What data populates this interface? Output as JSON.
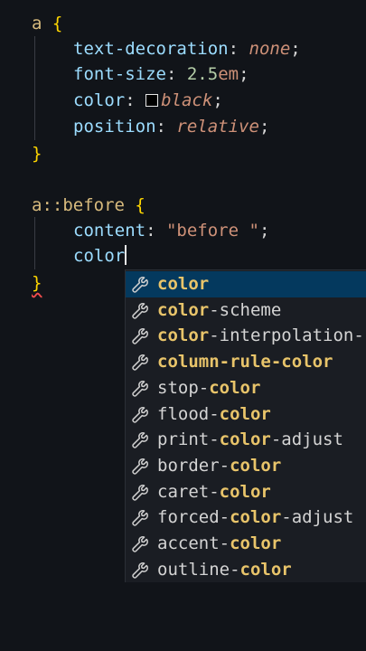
{
  "code": {
    "rule1_selector": "a",
    "open_brace": "{",
    "close_brace": "}",
    "decl1_prop": "text-decoration",
    "decl1_value": "none",
    "decl2_prop": "font-size",
    "decl2_num": "2.5",
    "decl2_unit": "em",
    "decl3_prop": "color",
    "decl3_value": "black",
    "decl4_prop": "position",
    "decl4_value": "relative",
    "rule2_selector_tag": "a",
    "rule2_pseudo": "::before",
    "content_prop": "content",
    "content_value": "\"before \"",
    "typing_text": "color",
    "colon": ":",
    "semicolon": ";"
  },
  "suggestions": {
    "highlight": "color",
    "items": [
      {
        "pre": "",
        "match": "color",
        "post": ""
      },
      {
        "pre": "",
        "match": "color",
        "post": "-scheme"
      },
      {
        "pre": "",
        "match": "color",
        "post": "-interpolation-"
      },
      {
        "pre": "",
        "match": "column-rule-color",
        "post": ""
      },
      {
        "pre": "stop-",
        "match": "color",
        "post": ""
      },
      {
        "pre": "flood-",
        "match": "color",
        "post": ""
      },
      {
        "pre": "print-",
        "match": "color",
        "post": "-adjust"
      },
      {
        "pre": "border-",
        "match": "color",
        "post": ""
      },
      {
        "pre": "caret-",
        "match": "color",
        "post": ""
      },
      {
        "pre": "forced-",
        "match": "color",
        "post": "-adjust"
      },
      {
        "pre": "accent-",
        "match": "color",
        "post": ""
      },
      {
        "pre": "outline-",
        "match": "color",
        "post": ""
      }
    ]
  },
  "colors": {
    "background": "#111419",
    "selector": "#d7ba7d",
    "property": "#9cdcfe",
    "value": "#ce9178",
    "number": "#b5cea8",
    "brace": "#ffd700",
    "suggest_bg": "#1a1d23",
    "suggest_match": "#e8c46a",
    "color_swatch": "#000000"
  },
  "icons": {
    "suggestion_icon": "wrench-icon",
    "color_swatch": "color-swatch-icon"
  }
}
